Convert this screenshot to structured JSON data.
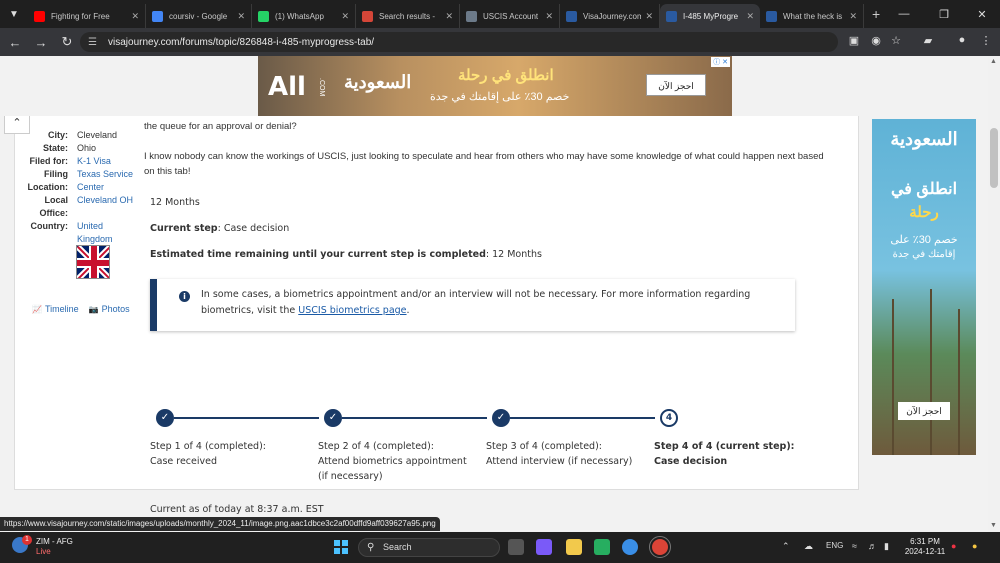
{
  "browser": {
    "tabs": [
      {
        "label": "Fighting for Free",
        "favicon": "youtube-icon",
        "color": "#ff0000"
      },
      {
        "label": "coursiv - Google",
        "favicon": "google-icon",
        "color": "#4285f4"
      },
      {
        "label": "(1) WhatsApp",
        "favicon": "whatsapp-icon",
        "color": "#25d366"
      },
      {
        "label": "Search results - ",
        "favicon": "gmail-icon",
        "color": "#d44638"
      },
      {
        "label": "USCIS Account",
        "favicon": "uscis-icon",
        "color": "#6c7a89"
      },
      {
        "label": "VisaJourney.com",
        "favicon": "visajourney-icon",
        "color": "#2a5aa0"
      },
      {
        "label": "I-485 MyProgre",
        "favicon": "visajourney-icon",
        "color": "#2a5aa0",
        "active": true
      },
      {
        "label": "What the heck is",
        "favicon": "visajourney-icon",
        "color": "#2a5aa0"
      }
    ],
    "url": "visajourney.com/forums/topic/826848-i-485-myprogress-tab/",
    "status_url": "https://www.visajourney.com/static/images/uploads/monthly_2024_11/image.png.aac1dbce3c2af00dffd9aff039627a95.png"
  },
  "ads": {
    "top": {
      "brand": "All",
      "brand_suffix": ".COM",
      "saudi_logo": "السعودية",
      "headline": "انطلق في رحلة",
      "offer": "خصم 30٪ على إقامتك في جدة",
      "cta": "احجز الآن"
    },
    "side": {
      "logo": "السعودية",
      "headline_1": "انطلق في",
      "headline_2": "رحلة",
      "offer_1": "خصم 30٪ على",
      "offer_2": "إقامتك في جدة",
      "cta": "احجز الآن"
    }
  },
  "profile": {
    "fields": [
      {
        "label": "City:",
        "value": "Cleveland"
      },
      {
        "label": "State:",
        "value": "Ohio"
      },
      {
        "label": "Filed for:",
        "value": "K-1 Visa"
      },
      {
        "label": "Filing",
        "value": "Texas Service"
      },
      {
        "label": "Location:",
        "value": "Center"
      },
      {
        "label": "Local",
        "value": "Cleveland OH"
      },
      {
        "label": "Office:",
        "value": ""
      },
      {
        "label": "Country:",
        "value": "United"
      },
      {
        "label": "",
        "value": "Kingdom"
      }
    ],
    "timeline_label": "Timeline",
    "photos_label": "Photos"
  },
  "post": {
    "line_1": "the queue for an approval or denial?",
    "line_2": "I know nobody can know the workings of USCIS, just looking to speculate and hear from others who may have some knowledge of what could happen next based",
    "line_3": "on this tab!"
  },
  "progress_tab": {
    "duration": "12 Months",
    "current_step_label": "Current step",
    "current_step_value": ": Case decision",
    "estimate_label": "Estimated time remaining until your current step is completed",
    "estimate_value": ": 12 Months",
    "alert_text": "In some cases, a biometrics appointment and/or an interview will not be necessary. For more information regarding biometrics, visit the ",
    "alert_link": "USCIS biometrics page",
    "alert_end": ".",
    "steps": [
      {
        "title": "Step 1 of 4 (completed):",
        "desc": "Case received",
        "state": "completed"
      },
      {
        "title": "Step 2 of 4 (completed):",
        "desc": "Attend biometrics appointment (if necessary)",
        "state": "completed"
      },
      {
        "title": "Step 3 of 4 (completed):",
        "desc": "Attend interview (if necessary)",
        "state": "completed"
      },
      {
        "title": "Step 4 of 4 (current step):",
        "desc": "Case decision",
        "state": "current",
        "number": "4"
      }
    ],
    "as_of": "Current as of today at 8:37 a.m. EST"
  },
  "taskbar": {
    "weather_title": "ZIM - AFG",
    "weather_sub": "Live",
    "weather_badge": "1",
    "search_placeholder": "Search",
    "language": "ENG",
    "time": "6:31 PM",
    "date": "2024-12-11"
  }
}
